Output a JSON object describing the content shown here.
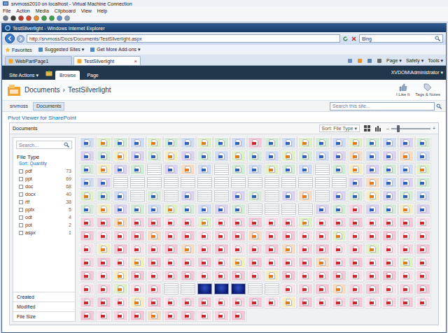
{
  "vm_window": {
    "title": "srvmoss2010 on localhost - Virtual Machine Connection",
    "menu": [
      "File",
      "Action",
      "Media",
      "Clipboard",
      "View",
      "Help"
    ]
  },
  "browser": {
    "title": "TestSilverlight - Windows Internet Explorer",
    "address": "http://srvmoss/Docs/Documents/TestSilverlight.aspx",
    "search": "Bing",
    "favorites": [
      "Favorites",
      "Suggested Sites ▾",
      "Get More Add-ons ▾"
    ],
    "tabs": [
      {
        "label": "WebPartPage1",
        "selected": false
      },
      {
        "label": "TestSilverlight",
        "selected": true
      }
    ],
    "tab_close": "×",
    "commands": [
      "Page ▾",
      "Safety ▾",
      "Tools ▾"
    ]
  },
  "sharepoint": {
    "site_actions": "Site Actions ▾",
    "ribbon_tabs": [
      {
        "label": "Browse",
        "selected": true
      },
      {
        "label": "Page",
        "selected": false
      }
    ],
    "user": "XVDOM\\Administrator ▾",
    "breadcrumb": [
      "Documents",
      "TestSilverlight"
    ],
    "separator": "›",
    "social": [
      "I Like It",
      "Tags & Notes"
    ],
    "nav": [
      {
        "label": "srvmoss",
        "selected": false
      },
      {
        "label": "Documents",
        "selected": true
      }
    ],
    "search_placeholder": "Search this site..."
  },
  "pivot": {
    "title": "Pivot Viewer for SharePoint",
    "collection": "Documents",
    "sort": "Sort: File Type ▾",
    "zoom": {
      "minus": "–",
      "plus": "+",
      "level": 0.15
    },
    "filter": {
      "search_placeholder": "Search...",
      "facet": "File Type",
      "facet_sort": "Sort: Quantity",
      "items": [
        {
          "label": "pdf",
          "count": "73",
          "checked": false
        },
        {
          "label": "ppt",
          "count": "69",
          "checked": false
        },
        {
          "label": "doc",
          "count": "68",
          "checked": false
        },
        {
          "label": "docx",
          "count": "40",
          "checked": false
        },
        {
          "label": "rtf",
          "count": "38",
          "checked": false
        },
        {
          "label": "pptx",
          "count": "5",
          "checked": false
        },
        {
          "label": "odt",
          "count": "4",
          "checked": false
        },
        {
          "label": "pot",
          "count": "2",
          "checked": false
        },
        {
          "label": "aspx",
          "count": "1",
          "checked": false
        }
      ],
      "collapsed_facets": [
        "Created",
        "Modified",
        "File Size"
      ]
    },
    "tiles": [
      [
        "doc",
        "ppt",
        "doc",
        "doc",
        "ppt",
        "doc",
        "doc",
        "ppt",
        "doc",
        "doc",
        "pdf",
        "doc",
        "doc",
        "ppt",
        "doc",
        "doc",
        "ppt",
        "doc",
        "doc",
        "doc",
        "doc"
      ],
      [
        "doc",
        "doc",
        "ppt",
        "doc",
        "doc",
        "ppt",
        "doc",
        "doc",
        "doc",
        "ppt",
        "doc",
        "doc",
        "ppt",
        "doc",
        "doc",
        "doc",
        "ppt",
        "doc",
        "doc",
        "ppt",
        "doc"
      ],
      [
        "doc",
        "ppt",
        "doc",
        "doc",
        "page",
        "doc",
        "ppt",
        "doc",
        "page",
        "doc",
        "doc",
        "ppt",
        "doc",
        "doc",
        "page",
        "doc",
        "ppt",
        "doc",
        "doc",
        "doc",
        "ppt"
      ],
      [
        "doc",
        "doc",
        "page",
        "page",
        "page",
        "page",
        "page",
        "page",
        "page",
        "page",
        "page",
        "page",
        "page",
        "page",
        "page",
        "page",
        "doc",
        "ppt",
        "doc",
        "doc",
        "doc"
      ],
      [
        "ppt",
        "doc",
        "doc",
        "page",
        "doc",
        "page",
        "doc",
        "page",
        "page",
        "doc",
        "doc",
        "page",
        "doc",
        "ppt",
        "page",
        "doc",
        "doc",
        "ppt",
        "doc",
        "doc",
        "doc"
      ],
      [
        "doc",
        "ppt",
        "doc",
        "doc",
        "doc",
        "ppt",
        "doc",
        "doc",
        "doc",
        "doc",
        "page",
        "page",
        "page",
        "page",
        "doc",
        "doc",
        "pdf",
        "doc",
        "doc",
        "ppt",
        "doc"
      ],
      [
        "pdf",
        "pdf",
        "ppt",
        "pdf",
        "pdf",
        "pdf",
        "pdf",
        "ppt",
        "pdf",
        "pdf",
        "pdf",
        "pdf",
        "pdf",
        "ppt",
        "pdf",
        "pdf",
        "pdf",
        "pdf",
        "pdf",
        "pdf",
        "pdf"
      ],
      [
        "pdf",
        "pdf",
        "pdf",
        "pdf",
        "ppt",
        "pdf",
        "pdf",
        "pdf",
        "pdf",
        "pdf",
        "ppt",
        "pdf",
        "pdf",
        "pdf",
        "pdf",
        "ppt",
        "pdf",
        "pdf",
        "pdf",
        "pdf",
        "pdf"
      ],
      [
        "pdf",
        "ppt",
        "pdf",
        "pdf",
        "pdf",
        "pdf",
        "ppt",
        "pdf",
        "pdf",
        "pdf",
        "pdf",
        "pdf",
        "ppt",
        "pdf",
        "pdf",
        "pdf",
        "pdf",
        "ppt",
        "pdf",
        "pdf",
        "pdf"
      ],
      [
        "pdf",
        "pdf",
        "pdf",
        "ppt",
        "pdf",
        "pdf",
        "pdf",
        "pdf",
        "pdf",
        "ppt",
        "pdf",
        "pdf",
        "pdf",
        "pdf",
        "ppt",
        "pdf",
        "pdf",
        "pdf",
        "pdf",
        "ppt",
        "pdf"
      ],
      [
        "pdf",
        "pdf",
        "ppt",
        "pdf",
        "pdf",
        "pdf",
        "pdf",
        "pdf",
        "pdf",
        "pdf",
        "pdf",
        "ppt",
        "pdf",
        "pdf",
        "pdf",
        "pdf",
        "pdf",
        "pdf",
        "pdf",
        "pdf",
        "pdf"
      ],
      [
        "pdf",
        "pdf",
        "ppt",
        "pdf",
        "pdf",
        "page",
        "page",
        "slide",
        "slide",
        "slide",
        "page",
        "page",
        "pdf",
        "pdf",
        "pdf",
        "ppt",
        "pdf",
        "pdf",
        "pdf",
        "pdf",
        "pdf"
      ],
      [
        "pdf",
        "pdf",
        "pdf",
        "ppt",
        "pdf",
        "pdf",
        "pdf",
        "pdf",
        "pdf",
        "pdf",
        "pdf",
        "pdf",
        "ppt",
        "pdf",
        "pdf",
        "pdf",
        "pdf",
        "pdf",
        "pdf",
        "pdf",
        "pdf"
      ],
      [
        "pdf",
        "pdf",
        "pdf",
        "pdf",
        "ppt",
        "pdf",
        "pdf",
        "pdf",
        "pdf",
        "pdf"
      ]
    ]
  }
}
